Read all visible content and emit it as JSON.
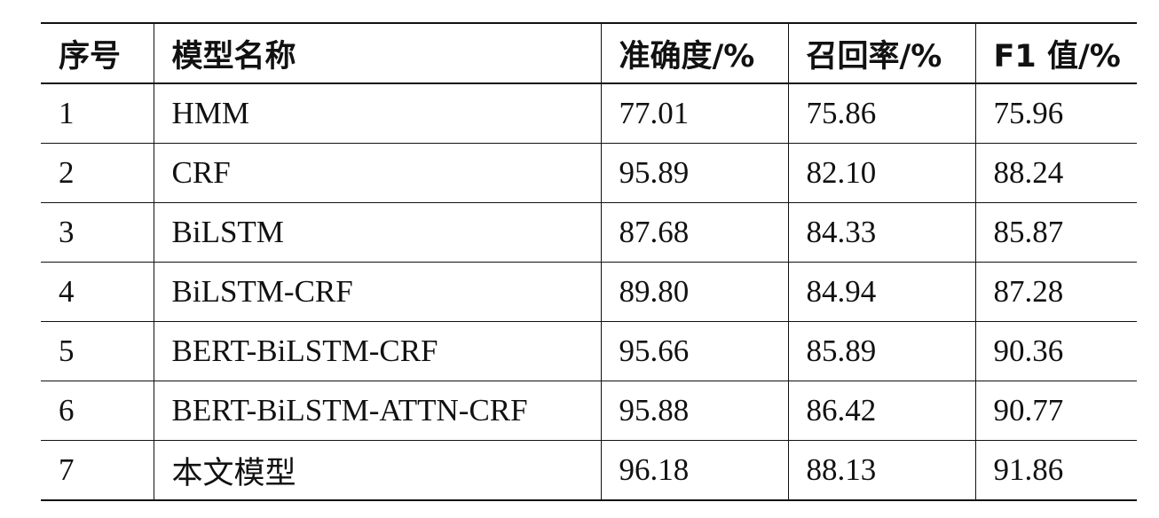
{
  "table": {
    "headers": [
      "序号",
      "模型名称",
      "准确度/%",
      "召回率/%",
      "F1 值/%"
    ],
    "rows": [
      [
        "1",
        "HMM",
        "77.01",
        "75.86",
        "75.96"
      ],
      [
        "2",
        "CRF",
        "95.89",
        "82.10",
        "88.24"
      ],
      [
        "3",
        "BiLSTM",
        "87.68",
        "84.33",
        "85.87"
      ],
      [
        "4",
        "BiLSTM-CRF",
        "89.80",
        "84.94",
        "87.28"
      ],
      [
        "5",
        "BERT-BiLSTM-CRF",
        "95.66",
        "85.89",
        "90.36"
      ],
      [
        "6",
        "BERT-BiLSTM-ATTN-CRF",
        "95.88",
        "86.42",
        "90.77"
      ],
      [
        "7",
        "本文模型",
        "96.18",
        "88.13",
        "91.86"
      ]
    ]
  }
}
